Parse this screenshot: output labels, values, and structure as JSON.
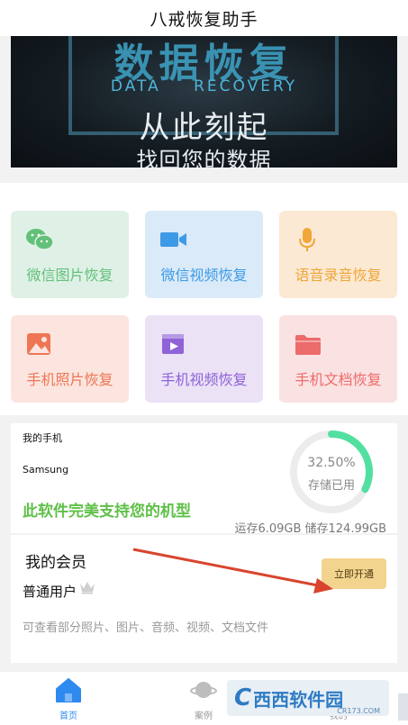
{
  "app": {
    "title": "八戒恢复助手"
  },
  "banner": {
    "headline": "数据恢复",
    "subtitle_en": "DATA RECOVERY",
    "line1": "从此刻起",
    "line2": "找回您的数据"
  },
  "features": [
    {
      "label": "微信图片恢复",
      "icon": "wechat-icon",
      "bg": "#dff1e6",
      "fg": "#63c07a"
    },
    {
      "label": "微信视频恢复",
      "icon": "video-camera-icon",
      "bg": "#dbeaf8",
      "fg": "#3d9ae6"
    },
    {
      "label": "语音录音恢复",
      "icon": "microphone-icon",
      "bg": "#fbe9d4",
      "fg": "#f0a638"
    },
    {
      "label": "手机照片恢复",
      "icon": "photo-icon",
      "bg": "#fbe5de",
      "fg": "#ee7655"
    },
    {
      "label": "手机视频恢复",
      "icon": "film-icon",
      "bg": "#ebe2f6",
      "fg": "#8f62d8"
    },
    {
      "label": "手机文档恢复",
      "icon": "folder-icon",
      "bg": "#fbe2e2",
      "fg": "#ec6b6b"
    }
  ],
  "phone": {
    "title": "我的手机",
    "model": "Samsung",
    "support_text": "此软件完美支持您的机型",
    "storage_percent_label": "32.50%",
    "storage_percent_value": 32.5,
    "storage_label": "存储已用",
    "memory_text": "运存6.09GB 储存124.99GB"
  },
  "vip": {
    "title": "我的会员",
    "user_type": "普通用户",
    "button_label": "立即开通",
    "description": "可查看部分照片、图片、音频、视频、文档文件"
  },
  "tabs": [
    {
      "label": "首页",
      "icon": "home-icon",
      "active": true
    },
    {
      "label": "案例",
      "icon": "planet-icon",
      "active": false
    },
    {
      "label": "我的",
      "icon": "user-icon",
      "active": false
    }
  ],
  "watermark": {
    "logo": "C",
    "text": "西西软件园",
    "sub": "CR173.COM"
  },
  "colors": {
    "accent": "#2f8af0",
    "support_green": "#5fc048",
    "ring_green": "#52e0a0",
    "vip_gold": "#f3d48e"
  }
}
